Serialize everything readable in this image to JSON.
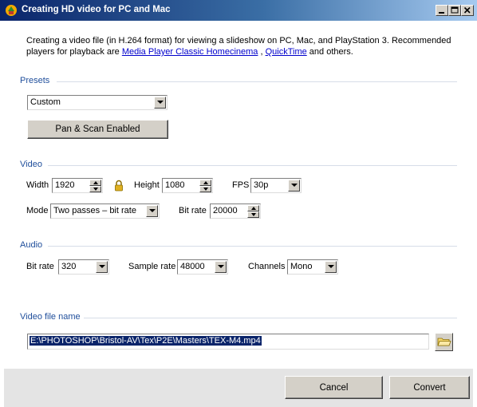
{
  "window": {
    "title": "Creating HD video for PC and Mac"
  },
  "description": {
    "text_before": "Creating a video file (in H.264 format) for viewing a slideshow on PC, Mac, and PlayStation 3. Recommended players for playback are ",
    "link1": "Media Player Classic Homecinema",
    "separator": " , ",
    "link2": "QuickTime",
    "text_after": " and others."
  },
  "presets": {
    "section_label": "Presets",
    "selected": "Custom",
    "pan_scan_button": "Pan & Scan Enabled"
  },
  "video": {
    "section_label": "Video",
    "width_label": "Width",
    "width_value": "1920",
    "height_label": "Height",
    "height_value": "1080",
    "fps_label": "FPS",
    "fps_value": "30p",
    "mode_label": "Mode",
    "mode_value": "Two passes – bit rate",
    "bitrate_label": "Bit rate",
    "bitrate_value": "20000"
  },
  "audio": {
    "section_label": "Audio",
    "bitrate_label": "Bit rate",
    "bitrate_value": "320",
    "samplerate_label": "Sample rate",
    "samplerate_value": "48000",
    "channels_label": "Channels",
    "channels_value": "Mono"
  },
  "output": {
    "section_label": "Video file name",
    "path": "E:\\PHOTOSHOP\\Bristol-AV\\Tex\\P2E\\Masters\\TEX-M4.mp4"
  },
  "footer": {
    "cancel_label": "Cancel",
    "convert_label": "Convert"
  },
  "colors": {
    "section_label": "#1f4e9b",
    "link": "#0000cc",
    "selection": "#0a246a"
  }
}
